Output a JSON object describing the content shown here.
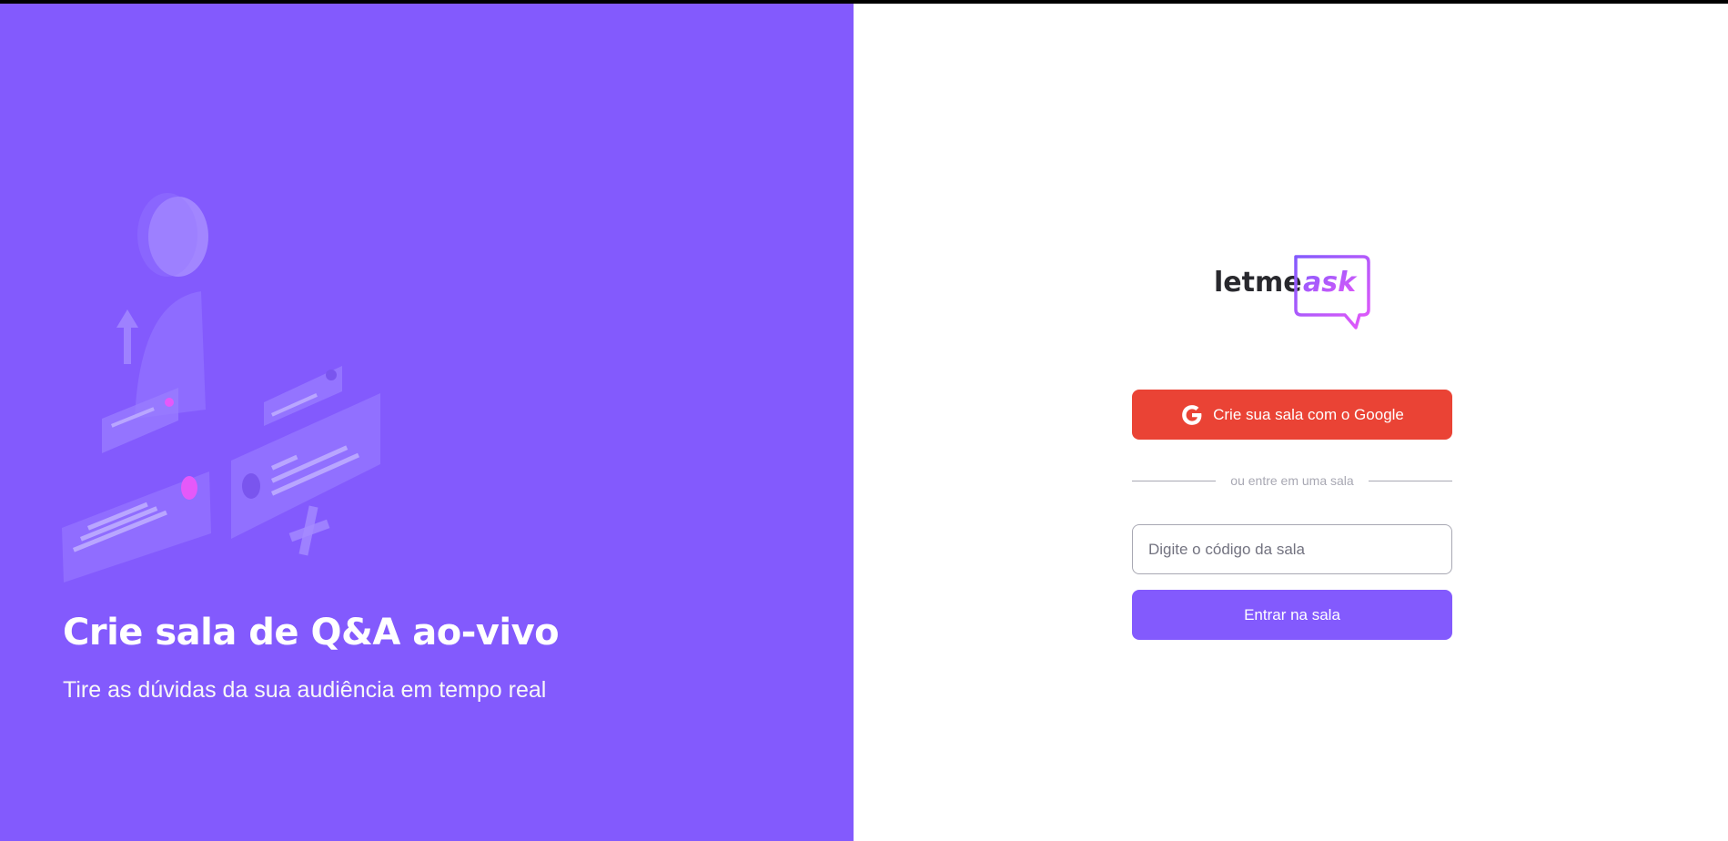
{
  "hero": {
    "title": "Crie sala de Q&A ao-vivo",
    "subtitle": "Tire as dúvidas da sua audiência em tempo real"
  },
  "logo": {
    "text_primary": "letme",
    "text_accent": "ask"
  },
  "google_button": {
    "label": "Crie sua sala com o Google",
    "icon": "google-icon"
  },
  "separator": {
    "text": "ou entre em uma sala"
  },
  "room_input": {
    "placeholder": "Digite o código da sala",
    "value": ""
  },
  "enter_button": {
    "label": "Entrar na sala"
  },
  "colors": {
    "brand_purple": "#835afd",
    "google_red": "#ea4335",
    "logo_dark": "#29292e",
    "logo_pink": "#e559f9"
  }
}
